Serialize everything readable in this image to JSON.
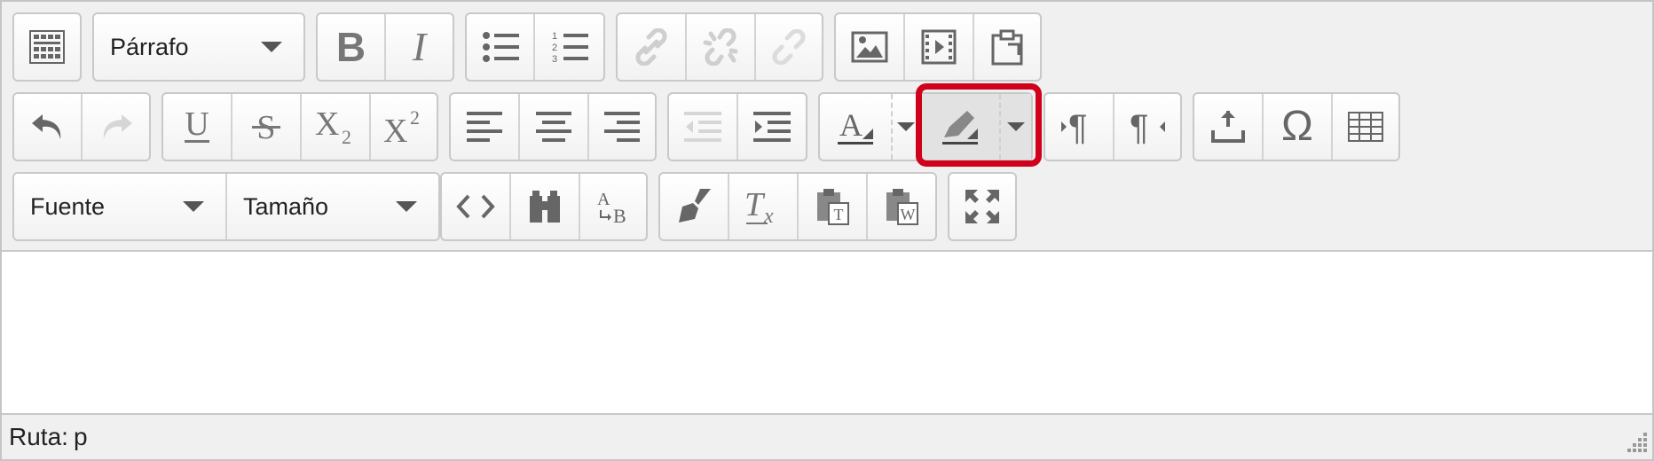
{
  "toolbar": {
    "format_select": {
      "value": "Párrafo"
    },
    "font_select": {
      "value": "Fuente"
    },
    "size_select": {
      "value": "Tamaño"
    },
    "icons": {
      "bold": "B",
      "italic": "I",
      "special_char": "Ω"
    },
    "highlighted_tool": "background-color",
    "highlight_color": "#d0021b"
  },
  "statusbar": {
    "path_label": "Ruta:",
    "path_value": "p"
  }
}
